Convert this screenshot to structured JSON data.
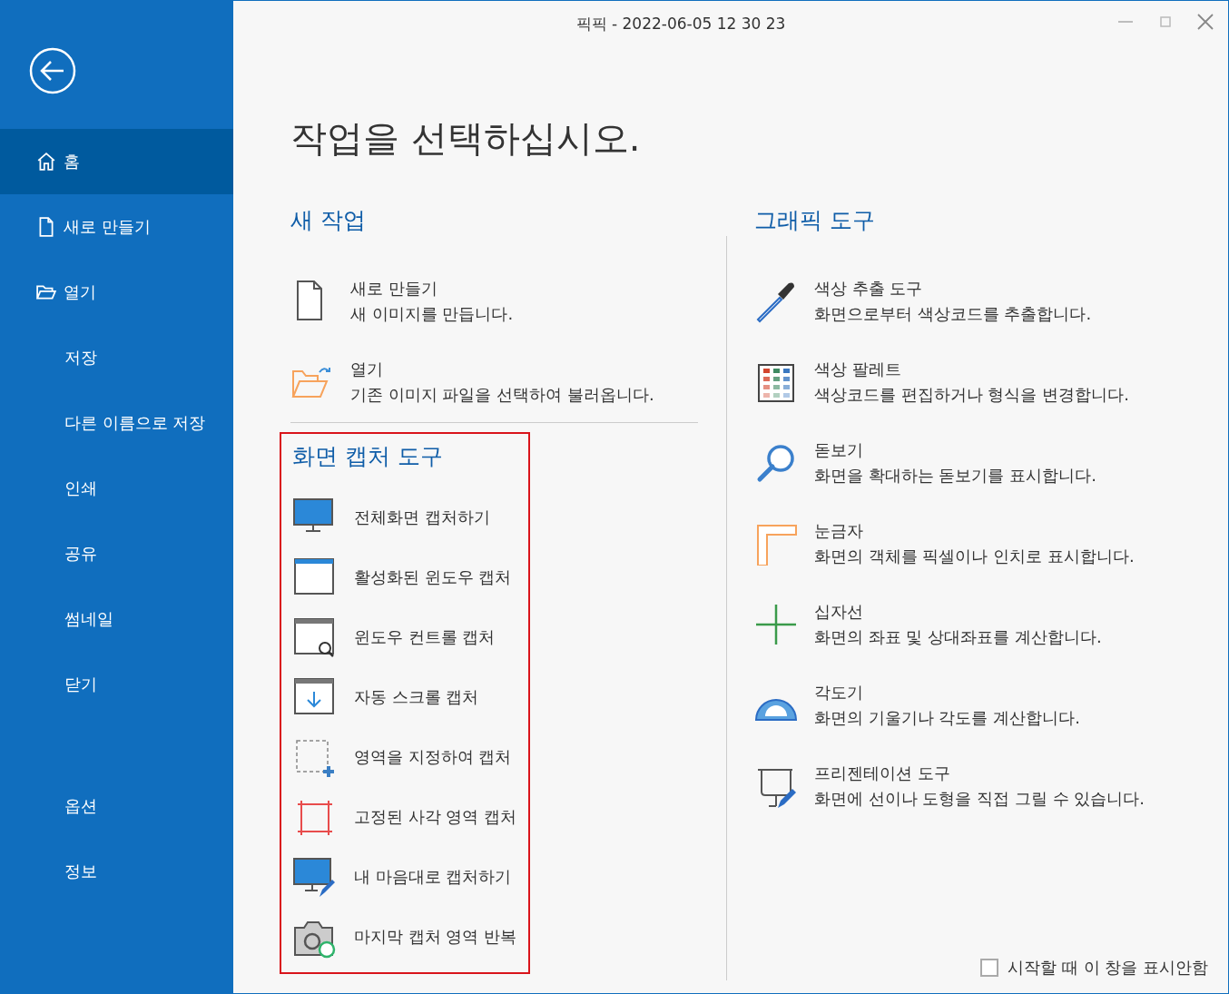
{
  "window": {
    "title": "픽픽 - 2022-06-05 12 30 23"
  },
  "sidebar": {
    "items": [
      {
        "label": "홈",
        "selected": true
      },
      {
        "label": "새로 만들기",
        "selected": false
      },
      {
        "label": "열기",
        "selected": false
      },
      {
        "label": "저장",
        "selected": false
      },
      {
        "label": "다른 이름으로 저장",
        "selected": false
      },
      {
        "label": "인쇄",
        "selected": false
      },
      {
        "label": "공유",
        "selected": false
      },
      {
        "label": "썸네일",
        "selected": false
      },
      {
        "label": "닫기",
        "selected": false
      },
      {
        "label": "옵션",
        "selected": false
      },
      {
        "label": "정보",
        "selected": false
      }
    ]
  },
  "heading": "작업을 선택하십시오.",
  "new_task": {
    "title": "새 작업",
    "items": [
      {
        "title": "새로 만들기",
        "description": "새 이미지를 만듭니다."
      },
      {
        "title": "열기",
        "description": "기존 이미지 파일을 선택하여 불러옵니다."
      }
    ]
  },
  "capture_tools": {
    "title": "화면 캡처 도구",
    "items": [
      {
        "label": "전체화면 캡처하기"
      },
      {
        "label": "활성화된 윈도우 캡처"
      },
      {
        "label": "윈도우 컨트롤 캡처"
      },
      {
        "label": "자동 스크롤 캡처"
      },
      {
        "label": "영역을 지정하여 캡처"
      },
      {
        "label": "고정된 사각 영역 캡처"
      },
      {
        "label": "내 마음대로 캡처하기"
      },
      {
        "label": "마지막 캡처 영역 반복"
      }
    ]
  },
  "graphic_tools": {
    "title": "그래픽 도구",
    "items": [
      {
        "title": "색상 추출 도구",
        "description": "화면으로부터 색상코드를 추출합니다."
      },
      {
        "title": "색상 팔레트",
        "description": "색상코드를 편집하거나 형식을 변경합니다."
      },
      {
        "title": "돋보기",
        "description": "화면을 확대하는 돋보기를 표시합니다."
      },
      {
        "title": "눈금자",
        "description": "화면의 객체를 픽셀이나 인치로 표시합니다."
      },
      {
        "title": "십자선",
        "description": "화면의 좌표 및 상대좌표를 계산합니다."
      },
      {
        "title": "각도기",
        "description": "화면의 기울기나 각도를 계산합니다."
      },
      {
        "title": "프리젠테이션 도구",
        "description": "화면에 선이나 도형을 직접 그릴 수 있습니다."
      }
    ]
  },
  "startup_checkbox": {
    "label": "시작할 때 이 창을 표시안함",
    "checked": false
  }
}
